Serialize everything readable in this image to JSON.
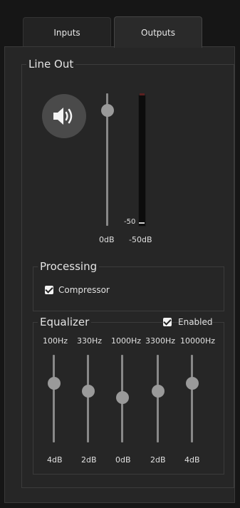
{
  "tabs": {
    "inputs": "Inputs",
    "outputs": "Outputs"
  },
  "line_out": {
    "legend": "Line Out",
    "volume_label": "0dB",
    "meter_tick_label": "-50",
    "meter_label": "-50dB"
  },
  "processing": {
    "legend": "Processing",
    "compressor_label": "Compressor",
    "compressor_checked": true
  },
  "equalizer": {
    "legend": "Equalizer",
    "enabled_label": "Enabled",
    "enabled_checked": true,
    "bands": [
      {
        "freq": "100Hz",
        "gain": "4dB"
      },
      {
        "freq": "330Hz",
        "gain": "2dB"
      },
      {
        "freq": "1000Hz",
        "gain": "0dB"
      },
      {
        "freq": "3300Hz",
        "gain": "2dB"
      },
      {
        "freq": "10000Hz",
        "gain": "4dB"
      }
    ]
  },
  "icons": {
    "speaker": "speaker-volume-icon",
    "check": "checkmark-icon"
  },
  "colors": {
    "background": "#161616",
    "panel": "#262626",
    "track": "#888888",
    "knob": "#9a9a9a"
  }
}
